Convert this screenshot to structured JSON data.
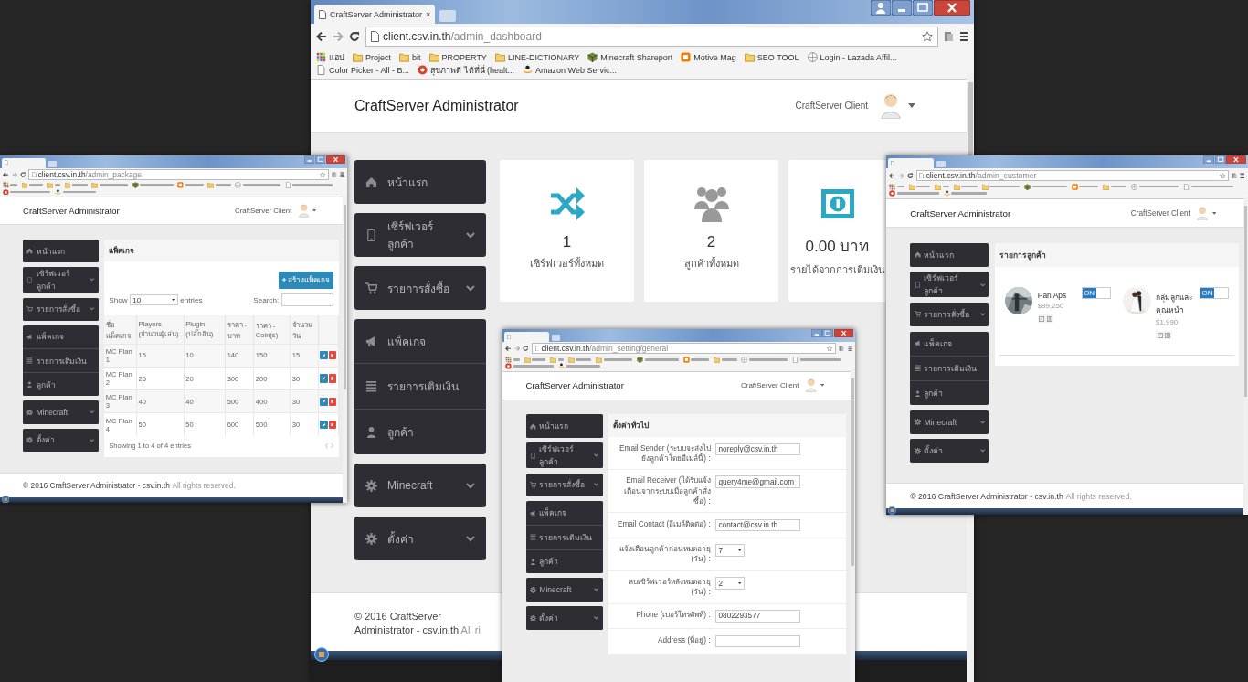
{
  "windows": [
    {
      "url": {
        "host": "client.csv.in.th",
        "path": "/admin_package"
      },
      "header": {
        "brand": "CraftServer Administrator",
        "user": "CraftServer Client"
      },
      "sidebar": [
        {
          "items": [
            {
              "label": "หน้าแรก",
              "expandable": false
            }
          ]
        },
        {
          "items": [
            {
              "label": "เซิร์ฟเวอร์ลูกค้า",
              "expandable": true
            }
          ]
        },
        {
          "items": [
            {
              "label": "รายการสั่งซื้อ",
              "expandable": true
            }
          ]
        },
        {
          "items": [
            {
              "label": "แพ็คเกจ",
              "expandable": false
            },
            {
              "label": "รายการเติมเงิน",
              "expandable": false
            },
            {
              "label": "ลูกค้า",
              "expandable": false
            }
          ]
        },
        {
          "items": [
            {
              "label": "Minecraft",
              "expandable": true
            }
          ]
        },
        {
          "items": [
            {
              "label": "ตั้งค่า",
              "expandable": true
            }
          ]
        }
      ],
      "page": {
        "kind": "table",
        "title": "แพ็คเกจ",
        "add_button": "สร้างแพ็คเกจ",
        "length": {
          "before": "Show",
          "value": "10",
          "after": "entries"
        },
        "search": {
          "label": "Search:"
        },
        "columns": [
          "ชื่อแพ็คเกจ",
          "Players (จำนวนผู้เล่น)",
          "Plugin (ปลั๊กอิน)",
          "ราคา - บาท",
          "ราคา - Coin(s)",
          "จำนวนวัน"
        ],
        "rows": [
          {
            "cells": [
              "MC Plan 1",
              "15",
              "10",
              "140",
              "150",
              "15"
            ]
          },
          {
            "cells": [
              "MC Plan 2",
              "25",
              "20",
              "300",
              "200",
              "30"
            ]
          },
          {
            "cells": [
              "MC Plan 3",
              "40",
              "40",
              "500",
              "400",
              "30"
            ]
          },
          {
            "cells": [
              "MC Plan 4",
              "50",
              "50",
              "600",
              "500",
              "30"
            ]
          }
        ],
        "info": "Showing 1 to 4 of 4 entries"
      },
      "footer": {
        "text": "© 2016 CraftServer Administrator - csv.in.th",
        "note": "All rights reserved."
      }
    },
    {
      "tab": {
        "title": "CraftServer Administrator",
        "close": "×"
      },
      "url": {
        "host": "client.csv.in.th",
        "path": "/admin_dashboard"
      },
      "bookmarks": [
        {
          "label": "แอป"
        },
        {
          "label": "Project"
        },
        {
          "label": "bit"
        },
        {
          "label": "PROPERTY"
        },
        {
          "label": "LINE-DICTIONARY"
        },
        {
          "label": "Minecraft Shareport"
        },
        {
          "label": "Motive Mag"
        },
        {
          "label": "SEO TOOL"
        },
        {
          "label": "Login - Lazada Affil..."
        },
        {
          "label": "Color Picker - All - B..."
        },
        {
          "label": "สุขภาพดี ได้ที่นี่ (healt..."
        },
        {
          "label": "Amazon Web Servic..."
        }
      ],
      "header": {
        "brand": "CraftServer Administrator",
        "user": "CraftServer Client"
      },
      "sidebar": [
        {
          "items": [
            {
              "label": "หน้าแรก",
              "expandable": false
            }
          ]
        },
        {
          "items": [
            {
              "label": "เซิร์ฟเวอร์ลูกค้า",
              "expandable": true
            }
          ]
        },
        {
          "items": [
            {
              "label": "รายการสั่งซื้อ",
              "expandable": true
            }
          ]
        },
        {
          "items": [
            {
              "label": "แพ็คเกจ",
              "expandable": false
            },
            {
              "label": "รายการเติมเงิน",
              "expandable": false
            },
            {
              "label": "ลูกค้า",
              "expandable": false
            }
          ]
        },
        {
          "items": [
            {
              "label": "Minecraft",
              "expandable": true
            }
          ]
        },
        {
          "items": [
            {
              "label": "ตั้งค่า",
              "expandable": true
            }
          ]
        }
      ],
      "page": {
        "kind": "dashboard",
        "stats": [
          {
            "value": "1",
            "label": "เซิร์ฟเวอร์ทั้งหมด"
          },
          {
            "value": "2",
            "label": "ลูกค้าทั้งหมด"
          },
          {
            "value": "0.00 บาท",
            "label": "รายได้จากการเติมเงิน"
          }
        ]
      },
      "footer": {
        "text": "© 2016 CraftServer Administrator - csv.in.th",
        "note": "All ri"
      }
    },
    {
      "url": {
        "host": "client.csv.in.th",
        "path": "/admin_setting/general"
      },
      "header": {
        "brand": "CraftServer Administrator",
        "user": "CraftServer Client"
      },
      "sidebar": [
        {
          "items": [
            {
              "label": "หน้าแรก",
              "expandable": false
            }
          ]
        },
        {
          "items": [
            {
              "label": "เซิร์ฟเวอร์ลูกค้า",
              "expandable": true
            }
          ]
        },
        {
          "items": [
            {
              "label": "รายการสั่งซื้อ",
              "expandable": true
            }
          ]
        },
        {
          "items": [
            {
              "label": "แพ็คเกจ",
              "expandable": false
            },
            {
              "label": "รายการเติมเงิน",
              "expandable": false
            },
            {
              "label": "ลูกค้า",
              "expandable": false
            }
          ]
        },
        {
          "items": [
            {
              "label": "Minecraft",
              "expandable": true
            }
          ]
        },
        {
          "items": [
            {
              "label": "ตั้งค่า",
              "expandable": true
            }
          ]
        }
      ],
      "page": {
        "kind": "form",
        "title": "ตั้งค่าทั่วไป",
        "fields": [
          {
            "label": "Email Sender (ระบบจะส่งไปยังลูกค้าโดยอีเมล์นี้) :",
            "kind": "text",
            "value": "noreply@csv.in.th"
          },
          {
            "label": "Email Receiver (ได้รับแจ้งเตือนจากระบบเมื่อลูกค้าสั่งซื้อ) :",
            "kind": "text",
            "value": "query4me@gmail.com"
          },
          {
            "label": "Email Contact (อีเมล์ติดต่อ) :",
            "kind": "text",
            "value": "contact@csv.in.th"
          },
          {
            "label": "แจ้งเตือนลูกค้าก่อนหมดอายุ (วัน) :",
            "kind": "select",
            "value": "7"
          },
          {
            "label": "ลบเซิร์ฟเวอร์หลังหมดอายุ (วัน) :",
            "kind": "select",
            "value": "2"
          },
          {
            "label": "Phone (เบอร์โทรศัพท์) :",
            "kind": "text",
            "value": "0802293577"
          },
          {
            "label": "Address (ที่อยู่) :",
            "kind": "text"
          }
        ]
      }
    },
    {
      "url": {
        "host": "client.csv.in.th",
        "path": "/admin_customer"
      },
      "header": {
        "brand": "CraftServer Administrator",
        "user": "CraftServer Client"
      },
      "sidebar": [
        {
          "items": [
            {
              "label": "หน้าแรก",
              "expandable": false
            }
          ]
        },
        {
          "items": [
            {
              "label": "เซิร์ฟเวอร์ลูกค้า",
              "expandable": true
            }
          ]
        },
        {
          "items": [
            {
              "label": "รายการสั่งซื้อ",
              "expandable": true
            }
          ]
        },
        {
          "items": [
            {
              "label": "แพ็คเกจ",
              "expandable": false
            },
            {
              "label": "รายการเติมเงิน",
              "expandable": false
            },
            {
              "label": "ลูกค้า",
              "expandable": false
            }
          ]
        },
        {
          "items": [
            {
              "label": "Minecraft",
              "expandable": true
            }
          ]
        },
        {
          "items": [
            {
              "label": "ตั้งค่า",
              "expandable": true
            }
          ]
        }
      ],
      "page": {
        "kind": "customers",
        "title": "รายการลูกค้า",
        "customers": [
          {
            "name": "Pan Aps",
            "amount": "$99,250",
            "toggle": {
              "label": "ON",
              "on": true
            }
          },
          {
            "name": "กลุ่มลูกและคุณหน้า",
            "amount": "$1,990",
            "toggle": {
              "label": "ON",
              "on": true
            }
          }
        ]
      },
      "footer": {
        "text": "© 2016 CraftServer Administrator - csv.in.th",
        "note": "All rights reserved."
      }
    }
  ]
}
